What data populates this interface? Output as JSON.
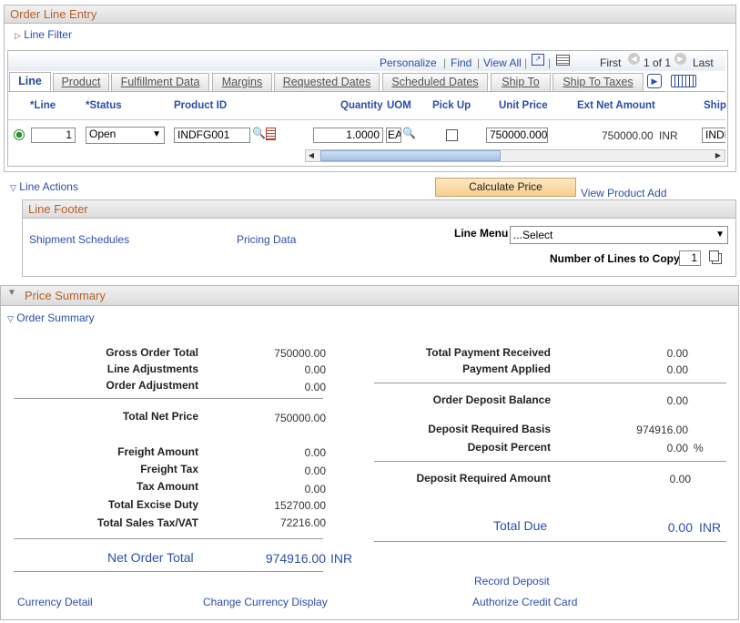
{
  "order_line_entry": {
    "title": "Order Line Entry",
    "line_filter": "Line Filter",
    "toolbar": {
      "personalize": "Personalize",
      "find": "Find",
      "view_all": "View All",
      "first": "First",
      "page_info": "1 of 1",
      "last": "Last"
    },
    "tabs": [
      "Line",
      "Product",
      "Fulfillment Data",
      "Margins",
      "Requested Dates",
      "Scheduled Dates",
      "Ship To",
      "Ship To Taxes"
    ],
    "columns": {
      "line": "*Line",
      "status": "*Status",
      "product_id": "Product ID",
      "quantity": "Quantity",
      "uom": "UOM",
      "pick_up": "Pick Up",
      "unit_price": "Unit Price",
      "ext_net_amount": "Ext Net Amount",
      "ship": "Ship"
    },
    "row": {
      "line": "1",
      "status": "Open",
      "product_id": "INDFG001",
      "quantity": "1.0000",
      "uom": "EA",
      "pick_up": false,
      "unit_price": "750000.000",
      "ext_net_amount": "750000.00",
      "currency": "INR",
      "ship": "INDF"
    }
  },
  "line_actions": {
    "label": "Line Actions",
    "calculate_price": "Calculate Price",
    "view_product_add": "View Product Add"
  },
  "line_footer": {
    "title": "Line Footer",
    "shipment_schedules": "Shipment Schedules",
    "pricing_data": "Pricing Data",
    "line_menu_label": "Line Menu",
    "line_menu_value": "...Select",
    "lines_to_copy_label": "Number of Lines to Copy",
    "lines_to_copy_value": "1"
  },
  "price_summary": {
    "title": "Price Summary",
    "order_summary": "Order Summary",
    "left": {
      "gross_order_total": {
        "label": "Gross Order Total",
        "value": "750000.00"
      },
      "line_adjustments": {
        "label": "Line Adjustments",
        "value": "0.00"
      },
      "order_adjustment": {
        "label": "Order Adjustment",
        "value": "0.00"
      },
      "total_net_price": {
        "label": "Total Net Price",
        "value": "750000.00"
      },
      "freight_amount": {
        "label": "Freight Amount",
        "value": "0.00"
      },
      "freight_tax": {
        "label": "Freight Tax",
        "value": "0.00"
      },
      "tax_amount": {
        "label": "Tax Amount",
        "value": "0.00"
      },
      "total_excise_duty": {
        "label": "Total Excise Duty",
        "value": "152700.00"
      },
      "total_sales_tax": {
        "label": "Total Sales Tax/VAT",
        "value": "72216.00"
      },
      "net_order_total": {
        "label": "Net Order Total",
        "value": "974916.00",
        "currency": "INR"
      }
    },
    "right": {
      "total_payment_received": {
        "label": "Total Payment Received",
        "value": "0.00"
      },
      "payment_applied": {
        "label": "Payment Applied",
        "value": "0.00"
      },
      "order_deposit_balance": {
        "label": "Order Deposit Balance",
        "value": "0.00"
      },
      "deposit_required_basis": {
        "label": "Deposit Required Basis",
        "value": "974916.00"
      },
      "deposit_percent": {
        "label": "Deposit Percent",
        "value": "0.00",
        "unit": "%"
      },
      "deposit_required_amount": {
        "label": "Deposit Required Amount",
        "value": "0.00"
      },
      "total_due": {
        "label": "Total Due",
        "value": "0.00",
        "currency": "INR"
      }
    },
    "links": {
      "record_deposit": "Record Deposit",
      "currency_detail": "Currency Detail",
      "change_currency_display": "Change Currency Display",
      "authorize_credit_card": "Authorize Credit Card"
    }
  }
}
